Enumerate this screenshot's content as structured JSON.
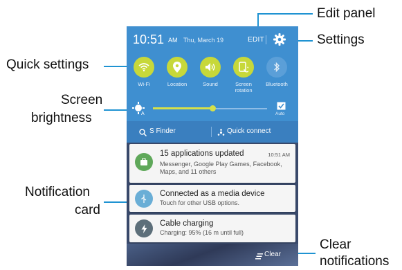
{
  "callouts": {
    "edit_panel": "Edit panel",
    "settings": "Settings",
    "quick_settings": "Quick settings",
    "brightness_line1": "Screen",
    "brightness_line2": "brightness",
    "notification_line1": "Notification",
    "notification_line2": "card",
    "clear_line1": "Clear",
    "clear_line2": "notifications"
  },
  "status": {
    "time": "10:51",
    "ampm": "AM",
    "date": "Thu, March 19",
    "edit": "EDIT"
  },
  "quick_settings": [
    {
      "label": "Wi-Fi",
      "icon": "wifi-icon",
      "state": "on"
    },
    {
      "label": "Location",
      "icon": "location-icon",
      "state": "on"
    },
    {
      "label": "Sound",
      "icon": "sound-icon",
      "state": "on"
    },
    {
      "label": "Screen rotation",
      "icon": "screen-rotation-icon",
      "state": "on"
    },
    {
      "label": "Bluetooth",
      "icon": "bluetooth-icon",
      "state": "off"
    }
  ],
  "brightness": {
    "level": 0.52,
    "auto_label": "Auto"
  },
  "finder_bar": {
    "s_finder": "S Finder",
    "quick_connect": "Quick connect"
  },
  "notifications": [
    {
      "title": "15 applications updated",
      "time": "10:51 AM",
      "body": "Messenger, Google Play Games, Facebook, Maps, and 11 others",
      "icon": "store-icon",
      "color": "#5fa85a"
    },
    {
      "title": "Connected as a media device",
      "body": "Touch for other USB options.",
      "icon": "usb-icon",
      "color": "#6aaed6"
    },
    {
      "title": "Cable charging",
      "body": "Charging: 95% (16 m until full)",
      "icon": "charging-icon",
      "color": "#5d6f7a"
    }
  ],
  "clear_button": "Clear",
  "colors": {
    "accent": "#1f93d2",
    "panel": "#3f8fd0",
    "toggle_on": "#c7d83a"
  }
}
